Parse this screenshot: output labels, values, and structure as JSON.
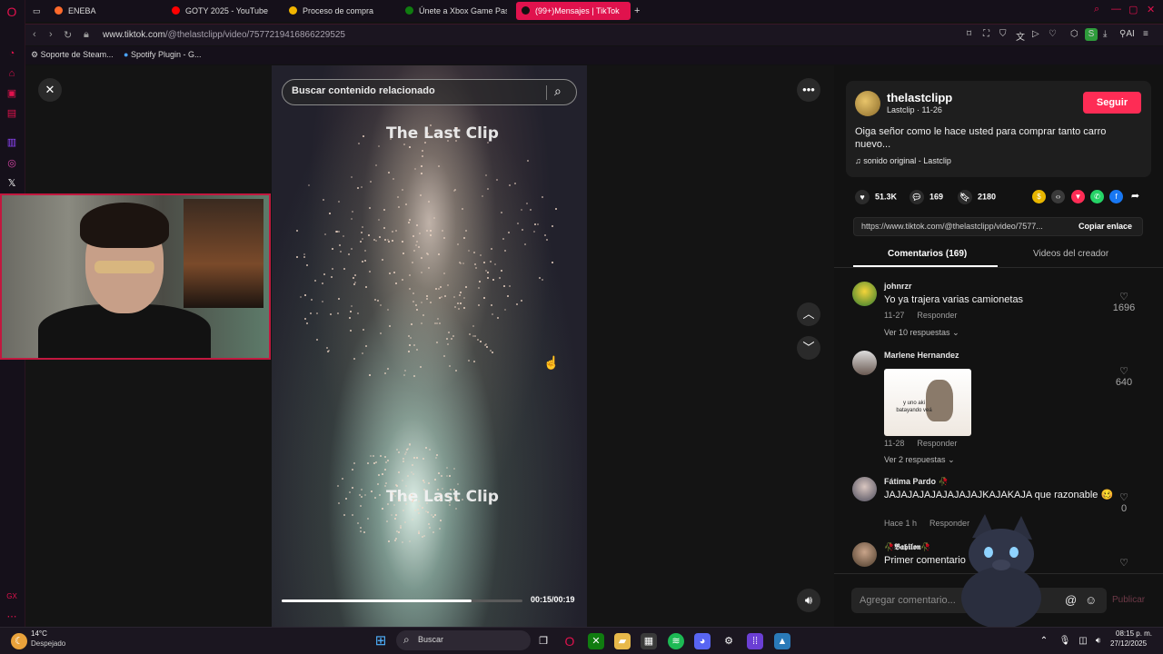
{
  "colors": {
    "accent": "#e0124d",
    "tiktok_red": "#fe2c55",
    "bg": "#121212"
  },
  "tabs": [
    {
      "label": "ENEBA",
      "icon": "eneba-icon"
    },
    {
      "label": "GOTY 2025 - YouTube",
      "icon": "youtube-icon"
    },
    {
      "label": "Proceso de compra",
      "icon": "checkout-icon"
    },
    {
      "label": "Únete a Xbox Game Pass",
      "icon": "xbox-icon"
    },
    {
      "label": "(99+)Mensajes | TikTok",
      "icon": "tiktok-icon"
    }
  ],
  "address": {
    "host": "www.tiktok.com",
    "path": "/@thelastclipp/video/7577219416866229525"
  },
  "bookmarks": [
    {
      "label": "Soporte de Steam..."
    },
    {
      "label": "Spotify Plugin - G..."
    }
  ],
  "video": {
    "search_placeholder": "Buscar contenido relacionado",
    "watermark": "The Last Clip",
    "time": "00:15/00:19",
    "progress": 0.79
  },
  "author": {
    "name": "thelastclipp",
    "meta": "Lastclip · 11-26",
    "follow_label": "Seguir",
    "description": "Oiga señor como le hace usted para comprar tanto carro nuevo...",
    "sound": "sonido original - Lastclip"
  },
  "stats": {
    "likes": "51.3K",
    "comments": "169",
    "saves": "2180"
  },
  "link": {
    "url": "https://www.tiktok.com/@thelastclipp/video/7577...",
    "copy_label": "Copiar enlace"
  },
  "panel_tabs": {
    "comments": "Comentarios (169)",
    "creator": "Videos del creador"
  },
  "comments": [
    {
      "user": "johnrzr",
      "text": "Yo ya trajera varias camionetas",
      "date": "11-27",
      "reply": "Responder",
      "more": "Ver 10 respuestas",
      "likes": "1696"
    },
    {
      "user": "Marlene Hernandez",
      "text": "",
      "sticker_text": "y uno aki batayando veá",
      "date": "11-28",
      "reply": "Responder",
      "more": "Ver 2 respuestas",
      "likes": "640"
    },
    {
      "user": "Fátima Pardo 🥀",
      "text": "JAJAJAJAJAJAJAJAJKAJAKAJA que razonable 🥴",
      "date": "Hace 1 h",
      "reply": "Responder",
      "likes": "0"
    },
    {
      "user": "🥀𝕭𝖆𝖇𝖎𝖑𝖔𝖓🥀",
      "text": "Primer comentario",
      "likes": ""
    }
  ],
  "comment_box": {
    "placeholder": "Agregar comentario...",
    "publish": "Publicar"
  },
  "taskbar": {
    "weather_temp": "14°C",
    "weather_desc": "Despejado",
    "search_label": "Buscar",
    "time": "08:15 p. m.",
    "date": "27/12/2025"
  }
}
